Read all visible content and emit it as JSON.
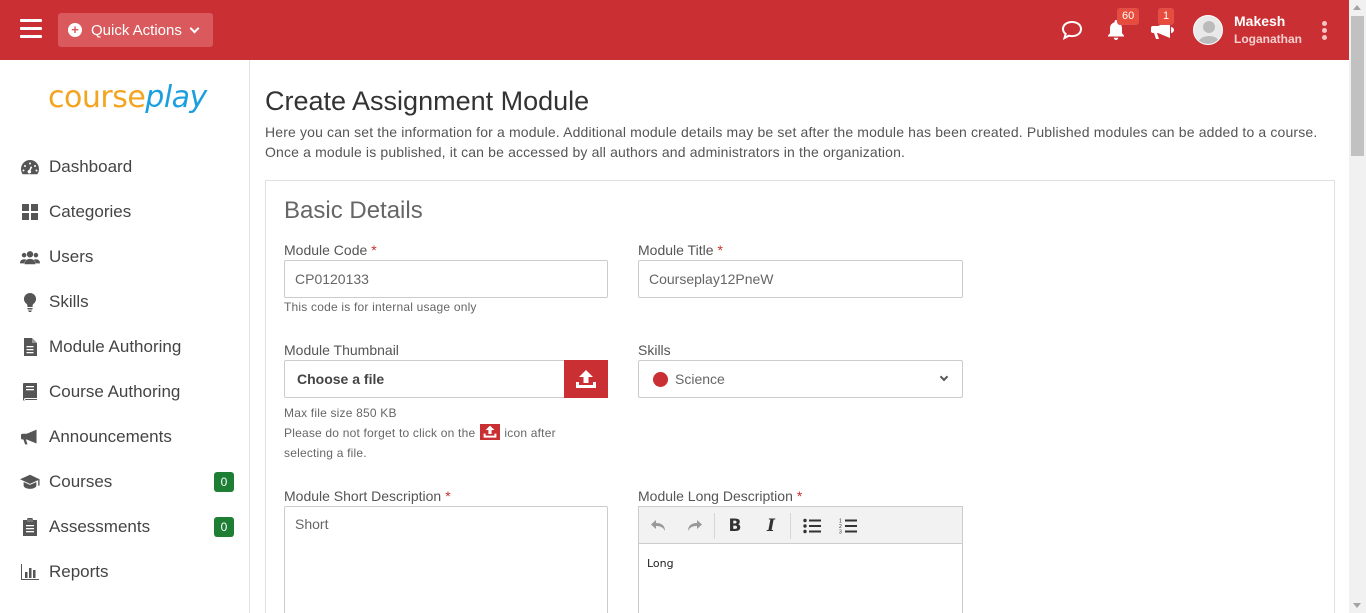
{
  "topbar": {
    "quick_actions_label": "Quick Actions",
    "notifications_count": "60",
    "announcements_count": "1",
    "user_first": "Makesh",
    "user_last": "Loganathan",
    "brand_color": "#c92f33"
  },
  "logo": {
    "part1": "course",
    "part2": "play"
  },
  "sidebar": {
    "items": [
      {
        "label": "Dashboard",
        "icon": "dashboard-icon"
      },
      {
        "label": "Categories",
        "icon": "grid-icon"
      },
      {
        "label": "Users",
        "icon": "users-icon"
      },
      {
        "label": "Skills",
        "icon": "lightbulb-icon"
      },
      {
        "label": "Module Authoring",
        "icon": "document-icon"
      },
      {
        "label": "Course Authoring",
        "icon": "book-icon"
      },
      {
        "label": "Announcements",
        "icon": "megaphone-icon"
      },
      {
        "label": "Courses",
        "icon": "graduation-cap-icon",
        "count": "0"
      },
      {
        "label": "Assessments",
        "icon": "clipboard-icon",
        "count": "0"
      },
      {
        "label": "Reports",
        "icon": "bar-chart-icon"
      }
    ]
  },
  "page": {
    "title": "Create Assignment Module",
    "description": "Here you can set the information for a module. Additional module details may be set after the module has been created. Published modules can be added to a course. Once a module is published, it can be accessed by all authors and administrators in the organization."
  },
  "form": {
    "section_title": "Basic Details",
    "module_code": {
      "label": "Module Code",
      "value": "CP0120133",
      "hint": "This code is for internal usage only"
    },
    "module_title": {
      "label": "Module Title",
      "value": "Courseplay12PneW"
    },
    "thumbnail": {
      "label": "Module Thumbnail",
      "choose_label": "Choose a file",
      "hint_size": "Max file size 850 KB",
      "hint_pre": "Please do not forget to click on the",
      "hint_post": "icon after",
      "hint_post2": "selecting a file."
    },
    "skills": {
      "label": "Skills",
      "value": "Science",
      "dot_color": "#c92f33"
    },
    "short_desc": {
      "label": "Module Short Description",
      "value": "Short"
    },
    "long_desc": {
      "label": "Module Long Description",
      "value": "Long"
    }
  }
}
